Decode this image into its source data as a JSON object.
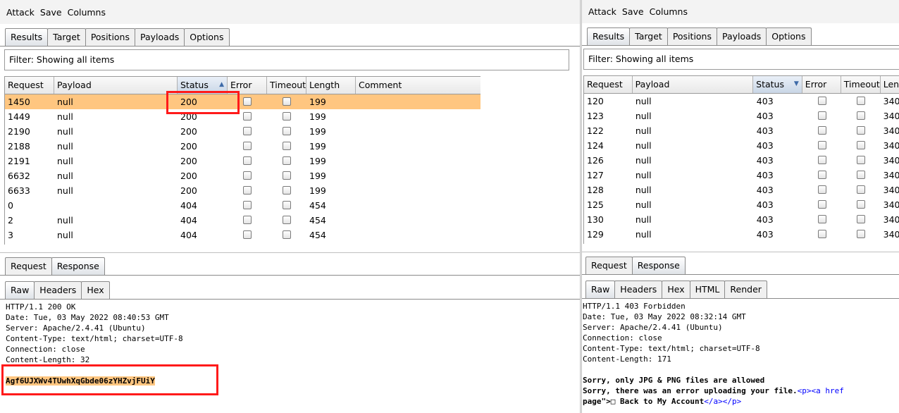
{
  "left": {
    "menu": [
      "Attack",
      "Save",
      "Columns"
    ],
    "tabs": [
      "Results",
      "Target",
      "Positions",
      "Payloads",
      "Options"
    ],
    "filter": "Filter: Showing all items",
    "columns": [
      "Request",
      "Payload",
      "Status",
      "Error",
      "Timeout",
      "Length",
      "Comment"
    ],
    "rows": [
      {
        "request": "1450",
        "payload": "null",
        "status": "200",
        "length": "199"
      },
      {
        "request": "1449",
        "payload": "null",
        "status": "200",
        "length": "199"
      },
      {
        "request": "2190",
        "payload": "null",
        "status": "200",
        "length": "199"
      },
      {
        "request": "2188",
        "payload": "null",
        "status": "200",
        "length": "199"
      },
      {
        "request": "2191",
        "payload": "null",
        "status": "200",
        "length": "199"
      },
      {
        "request": "6632",
        "payload": "null",
        "status": "200",
        "length": "199"
      },
      {
        "request": "6633",
        "payload": "null",
        "status": "200",
        "length": "199"
      },
      {
        "request": "0",
        "payload": "",
        "status": "404",
        "length": "454"
      },
      {
        "request": "2",
        "payload": "null",
        "status": "404",
        "length": "454"
      },
      {
        "request": "3",
        "payload": "null",
        "status": "404",
        "length": "454"
      }
    ],
    "reqresp_tabs": [
      "Request",
      "Response"
    ],
    "view_tabs": [
      "Raw",
      "Headers",
      "Hex"
    ],
    "response_lines": [
      "HTTP/1.1 200 OK",
      "Date: Tue, 03 May 2022 08:40:53 GMT",
      "Server: Apache/2.4.41 (Ubuntu)",
      "Content-Type: text/html; charset=UTF-8",
      "Connection: close",
      "Content-Length: 32"
    ],
    "response_body": "Agf6UJXWv4TUwhXqGbde06zYHZvjFUiY"
  },
  "right": {
    "menu": [
      "Attack",
      "Save",
      "Columns"
    ],
    "tabs": [
      "Results",
      "Target",
      "Positions",
      "Payloads",
      "Options"
    ],
    "filter": "Filter: Showing all items",
    "columns": [
      "Request",
      "Payload",
      "Status",
      "Error",
      "Timeout",
      "Len"
    ],
    "rows": [
      {
        "request": "120",
        "payload": "null",
        "status": "403",
        "length": "340"
      },
      {
        "request": "123",
        "payload": "null",
        "status": "403",
        "length": "340"
      },
      {
        "request": "122",
        "payload": "null",
        "status": "403",
        "length": "340"
      },
      {
        "request": "124",
        "payload": "null",
        "status": "403",
        "length": "340"
      },
      {
        "request": "126",
        "payload": "null",
        "status": "403",
        "length": "340"
      },
      {
        "request": "127",
        "payload": "null",
        "status": "403",
        "length": "340"
      },
      {
        "request": "128",
        "payload": "null",
        "status": "403",
        "length": "340"
      },
      {
        "request": "125",
        "payload": "null",
        "status": "403",
        "length": "340"
      },
      {
        "request": "130",
        "payload": "null",
        "status": "403",
        "length": "340"
      },
      {
        "request": "129",
        "payload": "null",
        "status": "403",
        "length": "340"
      }
    ],
    "reqresp_tabs": [
      "Request",
      "Response"
    ],
    "view_tabs": [
      "Raw",
      "Headers",
      "Hex",
      "HTML",
      "Render"
    ],
    "response_lines": [
      "HTTP/1.1 403 Forbidden",
      "Date: Tue, 03 May 2022 08:32:14 GMT",
      "Server: Apache/2.4.41 (Ubuntu)",
      "Connection: close",
      "Content-Type: text/html; charset=UTF-8",
      "Content-Length: 171"
    ],
    "body_line1": "Sorry, only JPG & PNG files are allowed",
    "body_line2_text": "Sorry, there was an error uploading your file.",
    "body_line2_tags": "<p><a href",
    "body_line3_prefix": "page\">",
    "body_line3_glyph": "□",
    "body_line3_text": " Back to My Account",
    "body_line3_tags": "</a></p>"
  }
}
